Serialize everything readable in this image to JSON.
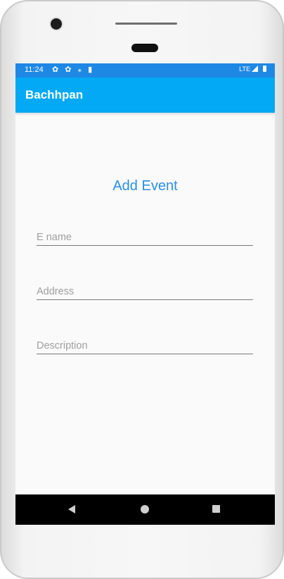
{
  "status_bar": {
    "time": "11:24",
    "left_icons": "✿ ✿ ⁎ ▮",
    "network": "LTE"
  },
  "app_bar": {
    "title": "Bachhpan"
  },
  "form": {
    "heading": "Add Event",
    "fields": [
      {
        "placeholder": "E name",
        "value": ""
      },
      {
        "placeholder": "Address",
        "value": ""
      },
      {
        "placeholder": "Description",
        "value": ""
      }
    ]
  },
  "nav": {
    "icons": [
      "back-icon",
      "home-icon",
      "recents-icon"
    ]
  },
  "colors": {
    "status_bar": "#1e88e5",
    "app_bar": "#03a9f4",
    "heading": "#2a8fe6",
    "screen_bg": "#fafafa"
  }
}
